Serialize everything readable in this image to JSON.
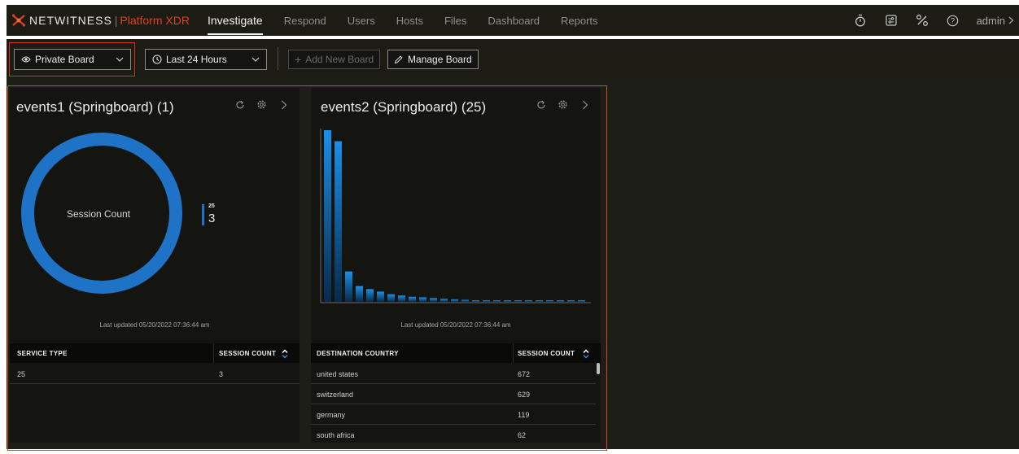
{
  "brand": {
    "name": "NETWITNESS",
    "product": "Platform XDR"
  },
  "nav": {
    "items": [
      {
        "label": "Investigate",
        "active": true
      },
      {
        "label": "Respond",
        "active": false
      },
      {
        "label": "Users",
        "active": false
      },
      {
        "label": "Hosts",
        "active": false
      },
      {
        "label": "Files",
        "active": false
      },
      {
        "label": "Dashboard",
        "active": false
      },
      {
        "label": "Reports",
        "active": false
      }
    ],
    "icons": [
      "timer-icon",
      "settings-sliders-icon",
      "tools-icon",
      "help-icon"
    ],
    "user": "admin"
  },
  "toolbar": {
    "board_select": "Private Board",
    "time_range": "Last 24 Hours",
    "add_board": "Add New Board",
    "manage_board": "Manage Board"
  },
  "colors": {
    "accent": "#e0401e",
    "chart": "#1f73c7",
    "bar_top": "#1a8fe8",
    "bar_bottom": "#072a4a"
  },
  "panels": [
    {
      "title": "events1 (Springboard) (1)",
      "updated": "Last updated 05/20/2022 07:36:44 am",
      "chart_label": "Session Count",
      "legend": {
        "key": "25",
        "value": "3"
      },
      "columns": [
        "SERVICE TYPE",
        "SESSION COUNT"
      ],
      "rows": [
        [
          "25",
          "3"
        ]
      ]
    },
    {
      "title": "events2 (Springboard) (25)",
      "updated": "Last updated 05/20/2022 07:36:44 am",
      "columns": [
        "DESTINATION COUNTRY",
        "SESSION COUNT"
      ],
      "rows": [
        [
          "united states",
          "672"
        ],
        [
          "switzerland",
          "629"
        ],
        [
          "germany",
          "119"
        ],
        [
          "south africa",
          "62"
        ]
      ]
    }
  ],
  "chart_data": [
    {
      "type": "pie",
      "title": "events1 (Springboard) (1)",
      "categories": [
        "25"
      ],
      "values": [
        3
      ],
      "center_label": "Session Count"
    },
    {
      "type": "bar",
      "title": "events2 (Springboard) (25)",
      "categories": [
        "united states",
        "switzerland",
        "germany",
        "south africa"
      ],
      "values": [
        672,
        629,
        119,
        62,
        50,
        40,
        30,
        25,
        20,
        18,
        15,
        12,
        10,
        8,
        6,
        5,
        4,
        3,
        3,
        2,
        2,
        2,
        1,
        1,
        1
      ],
      "grid": false
    }
  ]
}
